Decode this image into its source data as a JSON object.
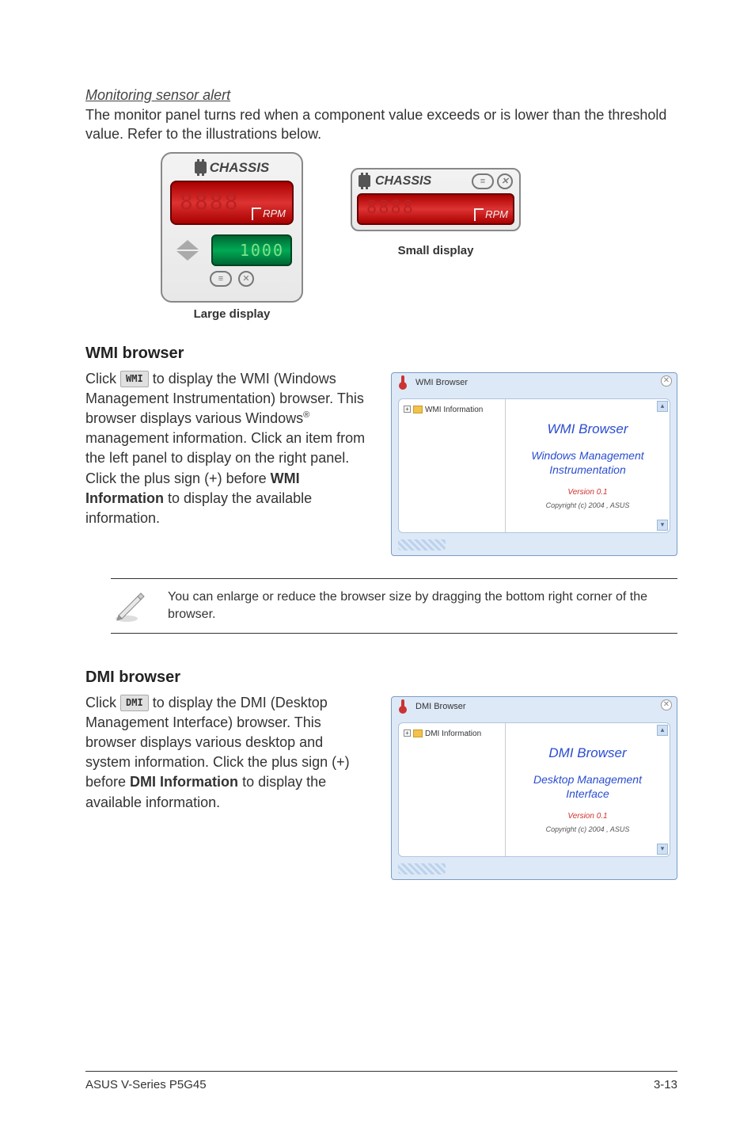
{
  "monitoring": {
    "heading": "Monitoring sensor alert",
    "para": "The monitor panel turns red when a component value exceeds or is lower than the threshold value. Refer to the illustrations below.",
    "chassis_label": "CHASSIS",
    "rpm_label": "RPM",
    "green_value": "1000",
    "large_caption": "Large display",
    "small_caption": "Small display"
  },
  "wmi": {
    "heading": "WMI browser",
    "btn_label": "WMI",
    "para_1a": "Click ",
    "para_1b": " to display the WMI (Windows Management Instrumentation) browser. This browser displays various Windows",
    "para_1c": " management information. Click an item from the left panel to display on the right panel. Click the plus sign (+) before ",
    "bold_text": "WMI Information",
    "para_1d": " to display the available information.",
    "window_title": "WMI Browser",
    "tree_label": "WMI Information",
    "content_title": "WMI Browser",
    "content_sub1": "Windows Management",
    "content_sub2": "Instrumentation",
    "version": "Version 0.1",
    "copyright": "Copyright (c) 2004 , ASUS"
  },
  "note": {
    "text": "You can enlarge or reduce the browser size by dragging the bottom right corner of the browser."
  },
  "dmi": {
    "heading": "DMI browser",
    "btn_label": "DMI",
    "para_1a": "Click ",
    "para_1b": " to display the DMI (Desktop Management Interface) browser. This browser displays various desktop and system information. Click the plus sign (+) before ",
    "bold_text": "DMI Information",
    "para_1d": " to display the available information.",
    "window_title": "DMI Browser",
    "tree_label": "DMI Information",
    "content_title": "DMI Browser",
    "content_sub1": "Desktop Management",
    "content_sub2": "Interface",
    "version": "Version 0.1",
    "copyright": "Copyright (c) 2004 , ASUS"
  },
  "footer": {
    "left": "ASUS V-Series P5G45",
    "right": "3-13"
  }
}
